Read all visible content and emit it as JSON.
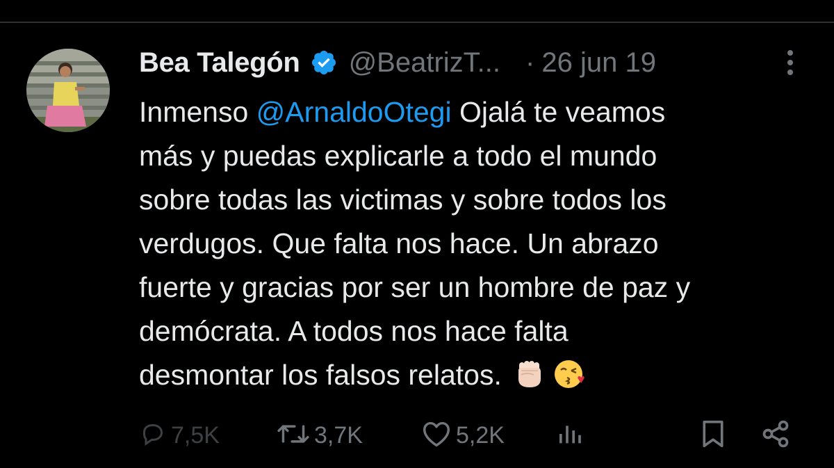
{
  "tweet": {
    "author_name": "Bea Talegón",
    "author_handle": "@BeatrizT...",
    "separator": "·",
    "date": "26 jun 19",
    "text_lines": [
      {
        "before": "Inmenso ",
        "mention": "@ArnaldoOtegi",
        "after": " Ojalá te veamos"
      },
      {
        "text": "más y puedas explicarle a todo el mundo"
      },
      {
        "text": "sobre todas las victimas y sobre todos los"
      },
      {
        "text": "verdugos. Que falta nos hace. Un abrazo"
      },
      {
        "text": "fuerte y gracias por ser un hombre de paz y"
      },
      {
        "text": "demócrata. A todos nos hace falta"
      },
      {
        "text": "desmontar los falsos relatos."
      }
    ],
    "emojis": [
      "raised-fist-emoji",
      "face-blowing-kiss-emoji"
    ]
  },
  "actions": {
    "reply": {
      "icon": "reply-icon",
      "count": "7,5K"
    },
    "retweet": {
      "icon": "retweet-icon",
      "count": "3,7K"
    },
    "like": {
      "icon": "heart-icon",
      "count": "5,2K"
    },
    "views": {
      "icon": "views-icon"
    },
    "bookmark": {
      "icon": "bookmark-icon"
    },
    "share": {
      "icon": "share-icon"
    }
  },
  "colors": {
    "background": "#000000",
    "text": "#e7e9ea",
    "secondary": "#71767b",
    "mention": "#1d9bf0",
    "verified": "#1d9bf0"
  }
}
